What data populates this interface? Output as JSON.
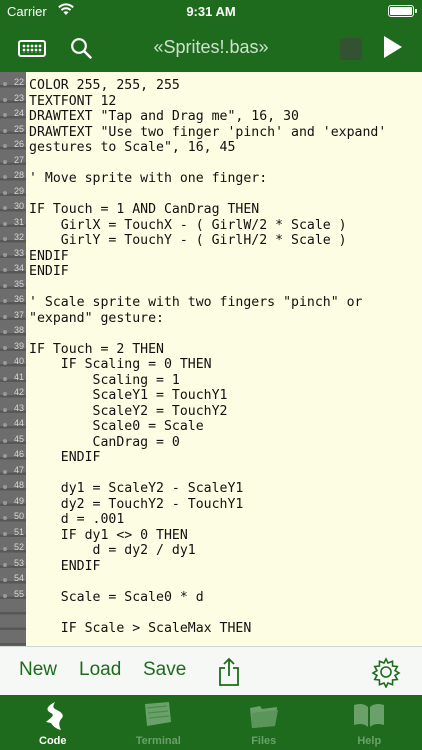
{
  "status": {
    "carrier": "Carrier",
    "time": "9:31 AM"
  },
  "nav": {
    "title": "«Sprites!.bas»"
  },
  "gutter_numbers": [
    "22",
    "23",
    "24",
    "25",
    "26",
    "27",
    "28",
    "29",
    "30",
    "31",
    "32",
    "33",
    "34",
    "35",
    "36",
    "37",
    "38",
    "39",
    "40",
    "41",
    "42",
    "43",
    "44",
    "45",
    "46",
    "47",
    "48",
    "49",
    "50",
    "51",
    "52",
    "53",
    "54",
    "55"
  ],
  "code_lines": [
    "COLOR 255, 255, 255",
    "TEXTFONT 12",
    "DRAWTEXT \"Tap and Drag me\", 16, 30",
    "DRAWTEXT \"Use two finger 'pinch' and 'expand'",
    "gestures to Scale\", 16, 45",
    "",
    "' Move sprite with one finger:",
    "",
    "IF Touch = 1 AND CanDrag THEN",
    "    GirlX = TouchX - ( GirlW/2 * Scale )",
    "    GirlY = TouchY - ( GirlH/2 * Scale )",
    "ENDIF",
    "ENDIF",
    "",
    "' Scale sprite with two fingers \"pinch\" or",
    "\"expand\" gesture:",
    "",
    "IF Touch = 2 THEN",
    "    IF Scaling = 0 THEN",
    "        Scaling = 1",
    "        ScaleY1 = TouchY1",
    "        ScaleY2 = TouchY2",
    "        Scale0 = Scale",
    "        CanDrag = 0",
    "    ENDIF",
    "",
    "    dy1 = ScaleY2 - ScaleY1",
    "    dy2 = TouchY2 - TouchY1",
    "    d = .001",
    "    IF dy1 <> 0 THEN",
    "        d = dy2 / dy1",
    "    ENDIF",
    "",
    "    Scale = Scale0 * d",
    "",
    "    IF Scale > ScaleMax THEN"
  ],
  "toolbar": {
    "new_label": "New",
    "load_label": "Load",
    "save_label": "Save"
  },
  "tabs": [
    {
      "label": "Code",
      "icon": "code-icon"
    },
    {
      "label": "Terminal",
      "icon": "terminal-icon"
    },
    {
      "label": "Files",
      "icon": "folder-icon"
    },
    {
      "label": "Help",
      "icon": "book-icon"
    }
  ],
  "colors": {
    "brand_green": "#1e6b1e",
    "editor_bg": "#fdfde3",
    "gutter": "#6d6d6d"
  }
}
